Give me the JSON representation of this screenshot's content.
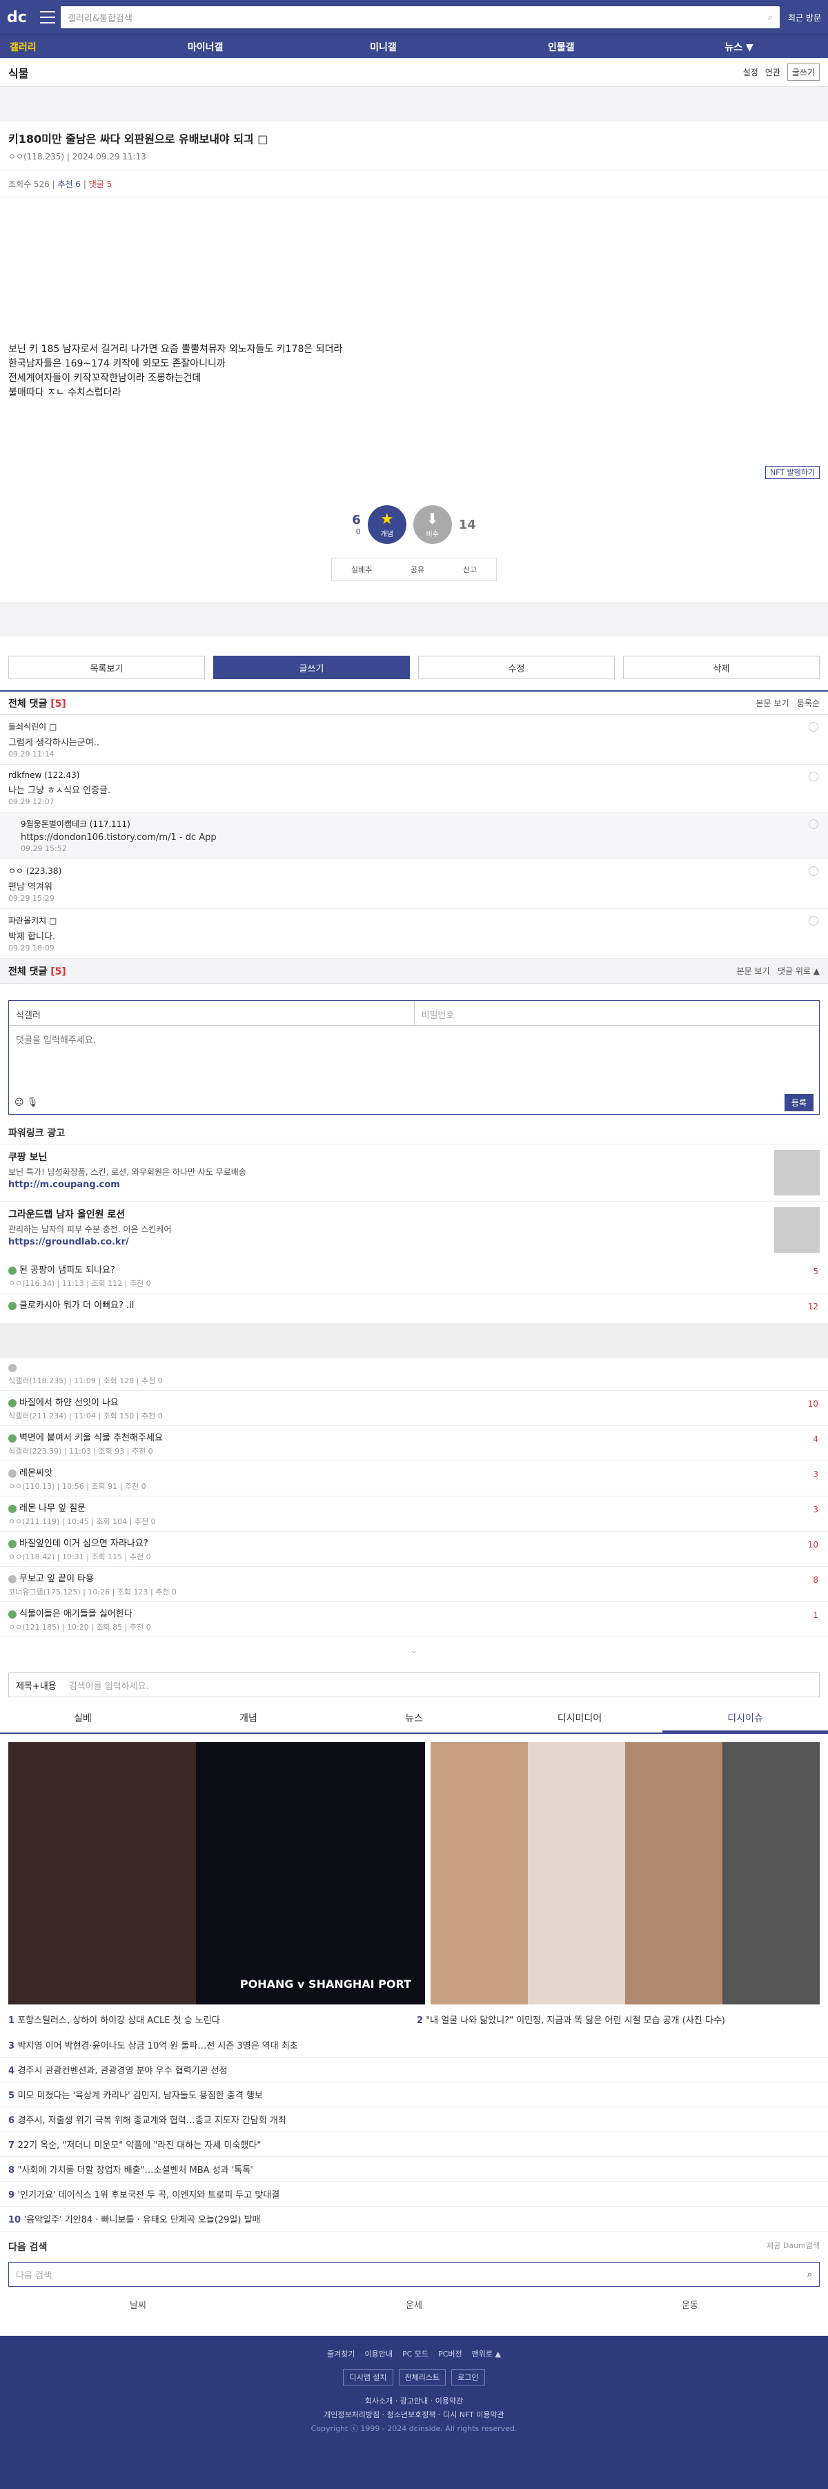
{
  "header": {
    "logo": "dc",
    "search_placeholder": "갤러리&통합검색",
    "recent": "최근 방문"
  },
  "nav": [
    "갤러리",
    "마이너갤",
    "미니갤",
    "인물갤",
    "뉴스 ▼"
  ],
  "gallery": {
    "title": "식물",
    "settings": "설정",
    "view": "연관",
    "write": "글쓰기"
  },
  "post": {
    "title": "키180미만 줄남은 싸다 외판원으로 유배보내야 되긔 □",
    "author": "ㅇㅇ(118.235)",
    "date": "2024.09.29 11:13",
    "views": "조회수 526",
    "recommend": "추천 6",
    "comments": "댓글 5",
    "body": [
      "보닌 키 185 남자로서 길거리 나가면 요즘 뿔뿔쳐뮤자 외노자들도 키178은 되더라",
      "한국남자들은 169~174 키작에 외모도 존잘아니니까",
      "전세계여자들이 키작꼬작한남이라 조롱하는건데",
      "불매따다 ㅈㄴ 수치스럽더라"
    ],
    "nft": "NFT 발행하기",
    "up": "6",
    "up_fixed": "0",
    "down": "14",
    "up_label": "개념",
    "down_label": "비추",
    "share": [
      "실베추",
      "공유",
      "신고"
    ]
  },
  "buttons": [
    "목록보기",
    "글쓰기",
    "수정",
    "삭제"
  ],
  "comments": {
    "title": "전체 댓글",
    "count": "[5]",
    "view": "본문 보기",
    "sort": "등록순",
    "items": [
      {
        "n": "돌쇠식린이 □",
        "t": "그럼게 생각하시는군여..",
        "d": "09.29 11:14"
      },
      {
        "n": "rdkfnew (122.43)",
        "t": "나는 그냥 ㅎㅅ식요 인증글.",
        "d": "09.29 12:07"
      },
      {
        "n": "9월웅돈벌이캠테크 (117.111)",
        "t": "https://dondon106.tistory.com/m/1 - dc App",
        "d": "09.29 15:52",
        "rep": true
      },
      {
        "n": "ㅇㅇ (223.38)",
        "t": "편남 역겨워",
        "d": "09.29 15:29"
      },
      {
        "n": "파란몰키치 □",
        "t": "박제 합니다.",
        "d": "09.29 18:09"
      }
    ],
    "foot_view": "본문 보기",
    "foot_top": "댓글 위로 ▲"
  },
  "form": {
    "name": "식갤러",
    "pw": "비밀번호",
    "placeholder": "댓글을 입력해주세요.",
    "submit": "등록"
  },
  "ads": {
    "title": "파워링크 광고",
    "items": [
      {
        "t": "쿠팡 보닌",
        "d": "보닌 특가! 남성화장품, 스킨, 로션, 와우회원은 하나만 사도 무료배송",
        "u": "http://m.coupang.com"
      },
      {
        "t": "그라운드랩 남자 올인원 로션",
        "d": "관리하는 남자의 피부 수분 충전. 이온 스킨케어",
        "u": "https://groundlab.co.kr/"
      }
    ]
  },
  "list": [
    {
      "t": "된 공팡이 냄피도 되나요?",
      "m": "ㅇㅇ(116.34) | 11:13 | 조회 112 | 추천 0",
      "c": "5"
    },
    {
      "t": "클로카시아 뭐가 더 이뻐요? .il",
      "m": "",
      "c": "12"
    },
    {
      "t": "",
      "m": "식갤러(118.235) | 11:09 | 조회 128 | 추천 0",
      "c": ""
    },
    {
      "t": "바질에서 하얀 선잇이 나요",
      "m": "식갤러(211.234) | 11:04 | 조회 150 | 추천 0",
      "c": "10"
    },
    {
      "t": "벽면에 붙여서 키울 식물 추천해주세요",
      "m": "식갤러(223.39) | 11:03 | 조회 93 | 추천 0",
      "c": "4"
    },
    {
      "t": "레몬씨앗",
      "m": "ㅇㅇ(110.13) | 10:56 | 조회 91 | 추천 0",
      "c": "3"
    },
    {
      "t": "레몬 나무 잎 질문",
      "m": "ㅇㅇ(211.119) | 10:45 | 조회 104 | 추천 0",
      "c": "3"
    },
    {
      "t": "바질잎인데 이거 심으면 자라나요?",
      "m": "ㅇㅇ(118.42) | 10:31 | 조회 115 | 추천 0",
      "c": "10"
    },
    {
      "t": "무보고 잎 끝이 타용",
      "m": "코너유그램(175.125) | 10:26 | 조회 123 | 추천 0",
      "c": "8"
    },
    {
      "t": "식물이들은 애기들을 싫어한다",
      "m": "ㅇㅇ(121.185) | 10:20 | 조회 85 | 추천 0",
      "c": "1"
    }
  ],
  "search": {
    "type": "제목+내용",
    "placeholder": "검색어를 입력하세요."
  },
  "tabs": [
    "실베",
    "개념",
    "뉴스",
    "디시미디어",
    "디시이슈"
  ],
  "media": {
    "img1": "POHANG v SHANGHAI PORT",
    "cap1": "포항스틸러스, 상하이 하이강 상대 ACLE 첫 승 노린다",
    "cap2": "\"내 얼굴 나와 닮았니?\" 이민정, 지금과 똑 닮은 어린 시절 모습 공개 (사진 다수)"
  },
  "news": [
    "박지영 이어 박현경·윤이나도 상금 10억 원 돌파…전 시즌 3명은 역대 최초",
    "경주시 관광컨벤션과, 관광경영 분야 우수 협력기관 선정",
    "미모 미쳤다는 '육상계 카리나' 김민지, 남자들도 용짐한 충격 행보",
    "경주시, 저출생 위기 극복 위해 종교계와 협력…종교 지도자 간담회 개최",
    "22기 옥순, \"저더니 미운모\" 악플에 \"라진 대하는 자세 미숙했다\"",
    "\"사회에 가치를 더할 창업자 배출\"…소셜벤처 MBA 성과 '톡톡'",
    "'인기가요' 데이식스 1위 후보국전 두 곡, 이엔지와 트로피 두고 맞대결",
    "'음악일주' 기안84 · 빠니보틀 · 유태오 단체곡 오늘(29일) 발매"
  ],
  "next": {
    "title": "다음 검색",
    "sub": "제공 Daum검색",
    "placeholder": "다음 검색",
    "links": [
      "날씨",
      "운세",
      "운동"
    ]
  },
  "footer": {
    "links": [
      "즐겨찾기",
      "이용안내",
      "PC 모드",
      "PC버전",
      "맨위로 ▲"
    ],
    "btns": [
      "디시앱 설치",
      "전체리스트",
      "로그인"
    ],
    "row1": "회사소개 · 광고안내 · 이용약관",
    "row2": "개인정보처리방침 · 청소년보호정책 · 디시 NFT 이용약관",
    "copy": "Copyright ⓒ 1999 - 2024 dcinside. All rights reserved."
  }
}
